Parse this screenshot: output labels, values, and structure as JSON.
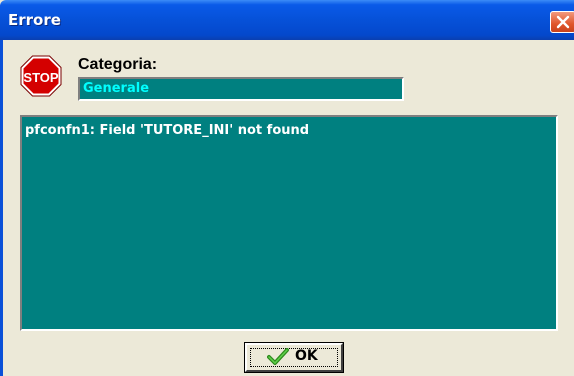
{
  "window": {
    "title": "Errore"
  },
  "icon": {
    "stop_text": "STOP"
  },
  "category": {
    "label": "Categoria:",
    "value": "Generale"
  },
  "message": {
    "text": "pfconfn1: Field 'TUTORE_INI' not found"
  },
  "buttons": {
    "ok_label": "OK"
  },
  "colors": {
    "titlebar": "#0651d8",
    "field_bg": "#008080",
    "category_text": "#00ffff",
    "message_text": "#ffffff",
    "close_button": "#e0552a",
    "stop_red": "#d40000"
  },
  "icons": [
    "close-icon",
    "stop-sign-icon",
    "checkmark-icon"
  ]
}
